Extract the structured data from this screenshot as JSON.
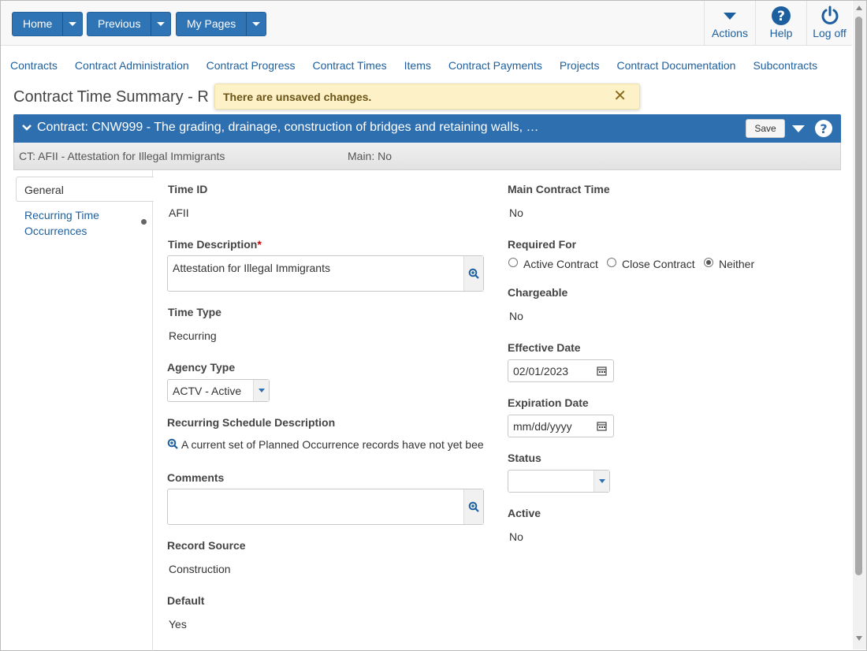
{
  "toolbar": {
    "home_label": "Home",
    "previous_label": "Previous",
    "mypages_label": "My Pages",
    "actions_label": "Actions",
    "help_label": "Help",
    "logoff_label": "Log off"
  },
  "nav": {
    "items": [
      "Contracts",
      "Contract Administration",
      "Contract Progress",
      "Contract Times",
      "Items",
      "Contract Payments",
      "Projects",
      "Contract Documentation",
      "Subcontracts"
    ]
  },
  "page": {
    "title": "Contract Time Summary - R",
    "unsaved_message": "There are unsaved changes.",
    "close_glyph": "✕"
  },
  "contract_header": {
    "title": "Contract: CNW999 - The grading, drainage, construction of bridges and retaining walls, …",
    "save_label": "Save",
    "ct_label": "CT: AFII - Attestation for Illegal Immigrants",
    "main_label": "Main: No"
  },
  "tabs": {
    "general": "General",
    "recurring": "Recurring Time Occurrences"
  },
  "form": {
    "time_id_label": "Time ID",
    "time_id_value": "AFII",
    "time_desc_label": "Time Description",
    "time_desc_required": "*",
    "time_desc_value": "Attestation for Illegal Immigrants",
    "time_type_label": "Time Type",
    "time_type_value": "Recurring",
    "agency_type_label": "Agency Type",
    "agency_type_value": "ACTV - Active",
    "sched_label": "Recurring Schedule Description",
    "sched_value": "A current set of Planned Occurrence records have not yet bee",
    "comments_label": "Comments",
    "comments_value": "",
    "record_source_label": "Record Source",
    "record_source_value": "Construction",
    "default_label": "Default",
    "default_value": "Yes",
    "main_time_label": "Main Contract Time",
    "main_time_value": "No",
    "required_for_label": "Required For",
    "required_for_options": [
      "Active Contract",
      "Close Contract",
      "Neither"
    ],
    "required_for_selected": "Neither",
    "chargeable_label": "Chargeable",
    "chargeable_value": "No",
    "effective_date_label": "Effective Date",
    "effective_date_value": "02/01/2023",
    "expiration_date_label": "Expiration Date",
    "expiration_date_placeholder": "mm/dd/yyyy",
    "status_label": "Status",
    "status_value": "",
    "active_label": "Active",
    "active_value": "No"
  },
  "colors": {
    "primary": "#2e6fb0",
    "link": "#1d5f9e",
    "toast_bg": "#fdf1c7"
  }
}
